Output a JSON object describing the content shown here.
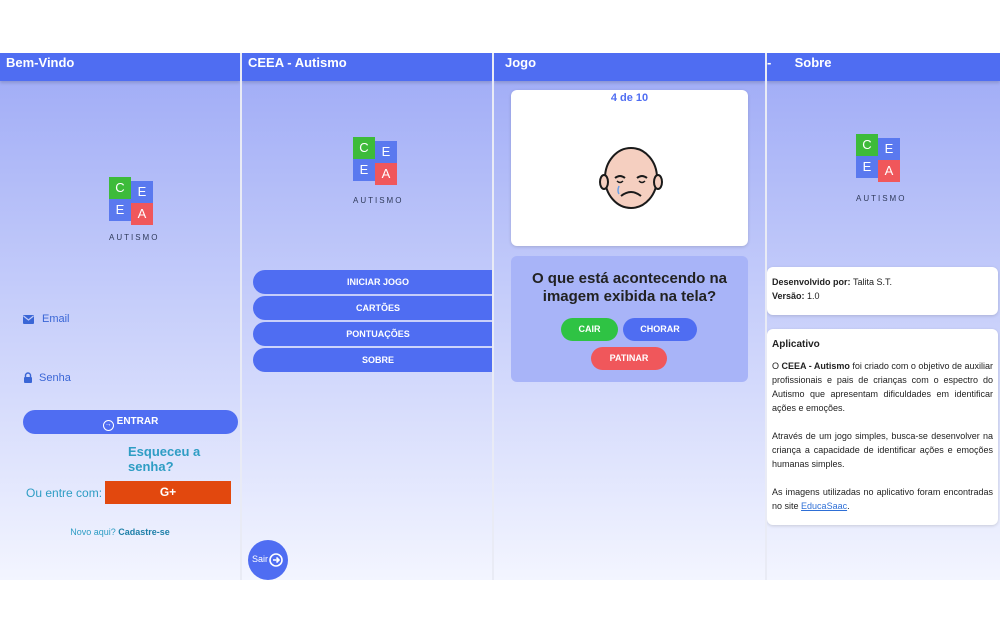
{
  "screens": {
    "welcome": {
      "title": "Bem-Vindo",
      "logo": {
        "letters": [
          "C",
          "E",
          "E",
          "A"
        ],
        "word": "AUTISMO"
      },
      "email_label": "Email",
      "password_label": "Senha",
      "login_button": "ENTRAR",
      "forgot_link": "Esqueceu a senha?",
      "alt_login_label": "Ou entre com:",
      "google_button": "G+",
      "signup_prefix": "Novo aqui?",
      "signup_link": "Cadastre-se"
    },
    "home": {
      "title": "CEEA - Autismo",
      "logo": {
        "letters": [
          "C",
          "E",
          "E",
          "A"
        ],
        "word": "AUTISMO"
      },
      "menu": [
        "INICIAR JOGO",
        "CARTÕES",
        "PONTUAÇÕES",
        "SOBRE"
      ],
      "exit_label": "Sair"
    },
    "game": {
      "title": "Jogo",
      "progress": "4 de 10",
      "question": "O que está acontecendo na imagem exibida na tela?",
      "options": [
        {
          "label": "CAIR",
          "color": "#2fc344"
        },
        {
          "label": "CHORAR",
          "color": "#4f6df2"
        },
        {
          "label": "PATINAR",
          "color": "#f0575b"
        }
      ]
    },
    "about": {
      "title": "Sobre",
      "logo": {
        "letters": [
          "C",
          "E",
          "E",
          "A"
        ],
        "word": "AUTISMO"
      },
      "dev_label": "Desenvolvido por:",
      "dev_value": "Talita S.T.",
      "version_label": "Versão:",
      "version_value": "1.0",
      "app_heading": "Aplicativo",
      "p1_prefix": "O",
      "p1_bold": "CEEA - Autismo",
      "p1_rest": "foi criado com o objetivo de auxiliar profissionais e pais de crianças com o espectro do Autismo que apresentam dificuldades em identificar ações e emoções.",
      "p2": "Através de um jogo simples, busca-se desenvolver na criança a capacidade de identificar ações e emoções humanas simples.",
      "p3_prefix": "As imagens utilizadas no aplicativo foram encontradas no site",
      "p3_link": "EducaSaac",
      "p3_suffix": "."
    }
  },
  "colors": {
    "primary": "#4f6df2",
    "green": "#2fc344",
    "red": "#f0575b",
    "google": "#e2480e",
    "link": "#2e9dc4"
  }
}
